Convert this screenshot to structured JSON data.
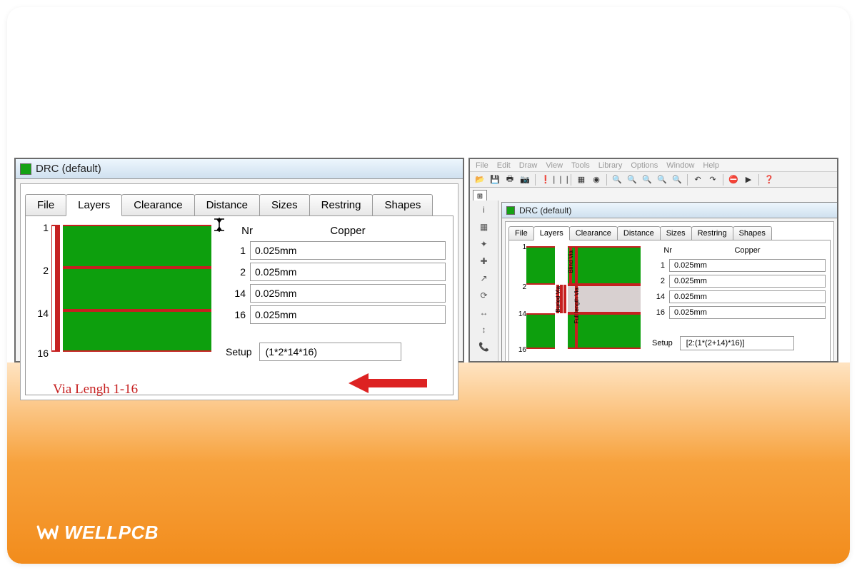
{
  "brand": "WELLPCB",
  "left_window": {
    "title": "DRC (default)",
    "tabs": [
      "File",
      "Layers",
      "Clearance",
      "Distance",
      "Sizes",
      "Restring",
      "Shapes"
    ],
    "active_tab": "Layers",
    "layer_marks": [
      "1",
      "2",
      "14",
      "16"
    ],
    "table": {
      "nr_header": "Nr",
      "copper_header": "Copper",
      "rows": [
        {
          "nr": "1",
          "val": "0.025mm"
        },
        {
          "nr": "2",
          "val": "0.025mm"
        },
        {
          "nr": "14",
          "val": "0.025mm"
        },
        {
          "nr": "16",
          "val": "0.025mm"
        }
      ]
    },
    "via_length_text": "Via Lengh  1-16",
    "setup_label": "Setup",
    "setup_value": "(1*2*14*16)"
  },
  "right_window": {
    "menu": [
      "File",
      "Edit",
      "Draw",
      "View",
      "Tools",
      "Library",
      "Options",
      "Window",
      "Help"
    ],
    "title": "DRC (default)",
    "tabs": [
      "File",
      "Layers",
      "Clearance",
      "Distance",
      "Sizes",
      "Restring",
      "Shapes"
    ],
    "active_tab": "Layers",
    "layer_marks": [
      "1",
      "2",
      "14",
      "16"
    ],
    "via_labels": {
      "buried": "Buried Via",
      "blind": "Blind Via",
      "full": "Full length Via"
    },
    "table": {
      "nr_header": "Nr",
      "copper_header": "Copper",
      "rows": [
        {
          "nr": "1",
          "val": "0.025mm"
        },
        {
          "nr": "2",
          "val": "0.025mm"
        },
        {
          "nr": "14",
          "val": "0.025mm"
        },
        {
          "nr": "16",
          "val": "0.025mm"
        }
      ]
    },
    "setup_label": "Setup",
    "setup_value": "[2:(1*(2+14)*16)]"
  }
}
